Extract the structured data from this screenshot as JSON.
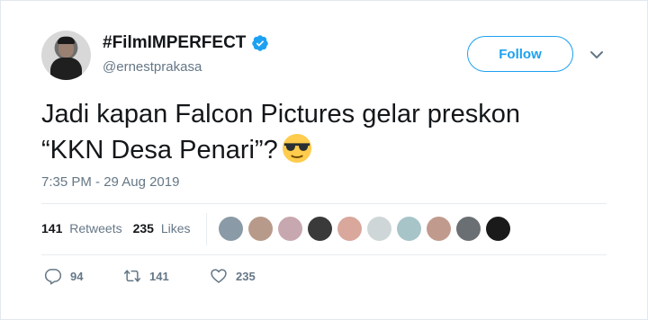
{
  "header": {
    "display_name": "#FilmIMPERFECT",
    "handle": "@ernestprakasa",
    "follow_label": "Follow"
  },
  "tweet": {
    "line1": "Jadi kapan Falcon Pictures gelar preskon",
    "line2": "“KKN Desa Penari”?",
    "emoji_icon": "sunglasses-face-icon",
    "timestamp": "7:35 PM - 29 Aug 2019"
  },
  "stats": {
    "retweets_count": "141",
    "retweets_label": "Retweets",
    "likes_count": "235",
    "likes_label": "Likes"
  },
  "actions": {
    "reply_count": "94",
    "retweet_count": "141",
    "like_count": "235"
  },
  "colors": {
    "accent": "#1da1f2",
    "text": "#14171a",
    "muted": "#657786",
    "border": "#e6ecf0"
  },
  "liker_avatars": [
    {
      "name": "liker-avatar-1",
      "color": "#8a9aa6"
    },
    {
      "name": "liker-avatar-2",
      "color": "#b89a8a"
    },
    {
      "name": "liker-avatar-3",
      "color": "#c8a8b0"
    },
    {
      "name": "liker-avatar-4",
      "color": "#3a3a3a"
    },
    {
      "name": "liker-avatar-5",
      "color": "#d9a79c"
    },
    {
      "name": "liker-avatar-6",
      "color": "#cfd6d8"
    },
    {
      "name": "liker-avatar-7",
      "color": "#a7c4c9"
    },
    {
      "name": "liker-avatar-8",
      "color": "#c19a8e"
    },
    {
      "name": "liker-avatar-9",
      "color": "#6a6f73"
    },
    {
      "name": "liker-avatar-10",
      "color": "#1a1a1a"
    }
  ]
}
